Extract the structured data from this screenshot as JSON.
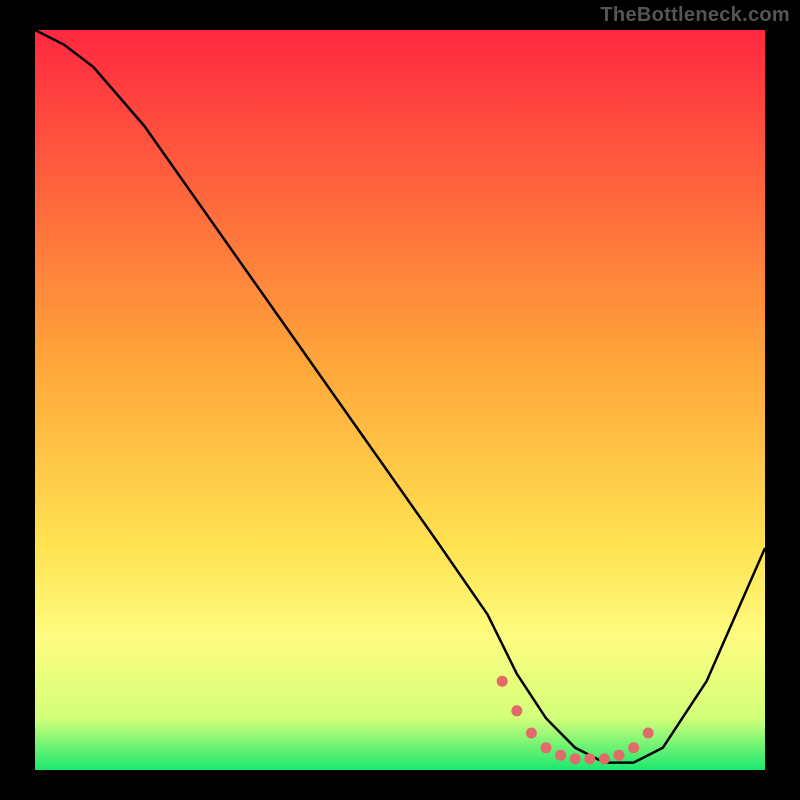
{
  "watermark": "TheBottleneck.com",
  "chart_data": {
    "type": "line",
    "title": "",
    "xlabel": "",
    "ylabel": "",
    "xlim": [
      0,
      100
    ],
    "ylim": [
      0,
      100
    ],
    "grid": false,
    "legend": false,
    "background_gradient": {
      "stops": [
        {
          "offset": 0,
          "color": "#ff2840"
        },
        {
          "offset": 45,
          "color": "#ffa63a"
        },
        {
          "offset": 70,
          "color": "#ffe352"
        },
        {
          "offset": 82,
          "color": "#fffc80"
        },
        {
          "offset": 93,
          "color": "#d3ff7a"
        },
        {
          "offset": 100,
          "color": "#1ae86e"
        }
      ]
    },
    "series": [
      {
        "name": "bottleneck-curve",
        "color": "#000000",
        "x": [
          0,
          4,
          8,
          15,
          25,
          35,
          45,
          55,
          62,
          66,
          70,
          74,
          78,
          82,
          86,
          92,
          100
        ],
        "values": [
          100,
          98,
          95,
          87,
          73,
          59,
          45,
          31,
          21,
          13,
          7,
          3,
          1,
          1,
          3,
          12,
          30
        ]
      }
    ],
    "markers": {
      "name": "highlight-region",
      "color": "#e26a6a",
      "x": [
        64,
        66,
        68,
        70,
        72,
        74,
        76,
        78,
        80,
        82,
        84
      ],
      "values": [
        12,
        8,
        5,
        3,
        2,
        1.5,
        1.5,
        1.5,
        2,
        3,
        5
      ]
    }
  }
}
